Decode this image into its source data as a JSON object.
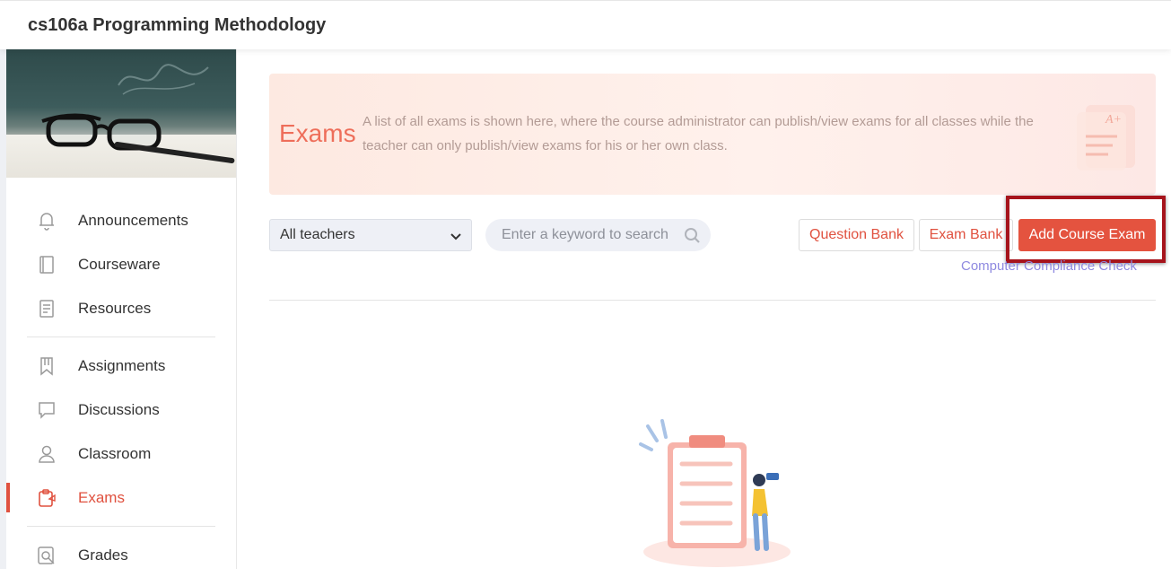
{
  "header": {
    "course_title": "cs106a Programming Methodology"
  },
  "sidebar": {
    "items": [
      {
        "label": "Announcements",
        "icon": "bell-icon",
        "active": false
      },
      {
        "label": "Courseware",
        "icon": "book-icon",
        "active": false
      },
      {
        "label": "Resources",
        "icon": "document-icon",
        "active": false
      },
      {
        "label": "Assignments",
        "icon": "bookmark-icon",
        "active": false
      },
      {
        "label": "Discussions",
        "icon": "chat-icon",
        "active": false
      },
      {
        "label": "Classroom",
        "icon": "person-icon",
        "active": false
      },
      {
        "label": "Exams",
        "icon": "clipboard-icon",
        "active": true
      },
      {
        "label": "Grades",
        "icon": "magnifier-icon",
        "active": false
      }
    ]
  },
  "hero": {
    "title": "Exams",
    "description": "A list of all exams is shown here, where the course administrator can publish/view exams for all classes while the teacher can only publish/view exams for his or her own class."
  },
  "filters": {
    "teacher_select": "All teachers",
    "search_placeholder": "Enter a keyword to search"
  },
  "actions": {
    "question_bank": "Question Bank",
    "exam_bank": "Exam Bank",
    "add_course_exam": "Add Course Exam",
    "compliance_link": "Computer Compliance Check"
  },
  "colors": {
    "accent": "#e4533f",
    "link": "#8e89e0",
    "highlight_border": "#a6141c"
  }
}
